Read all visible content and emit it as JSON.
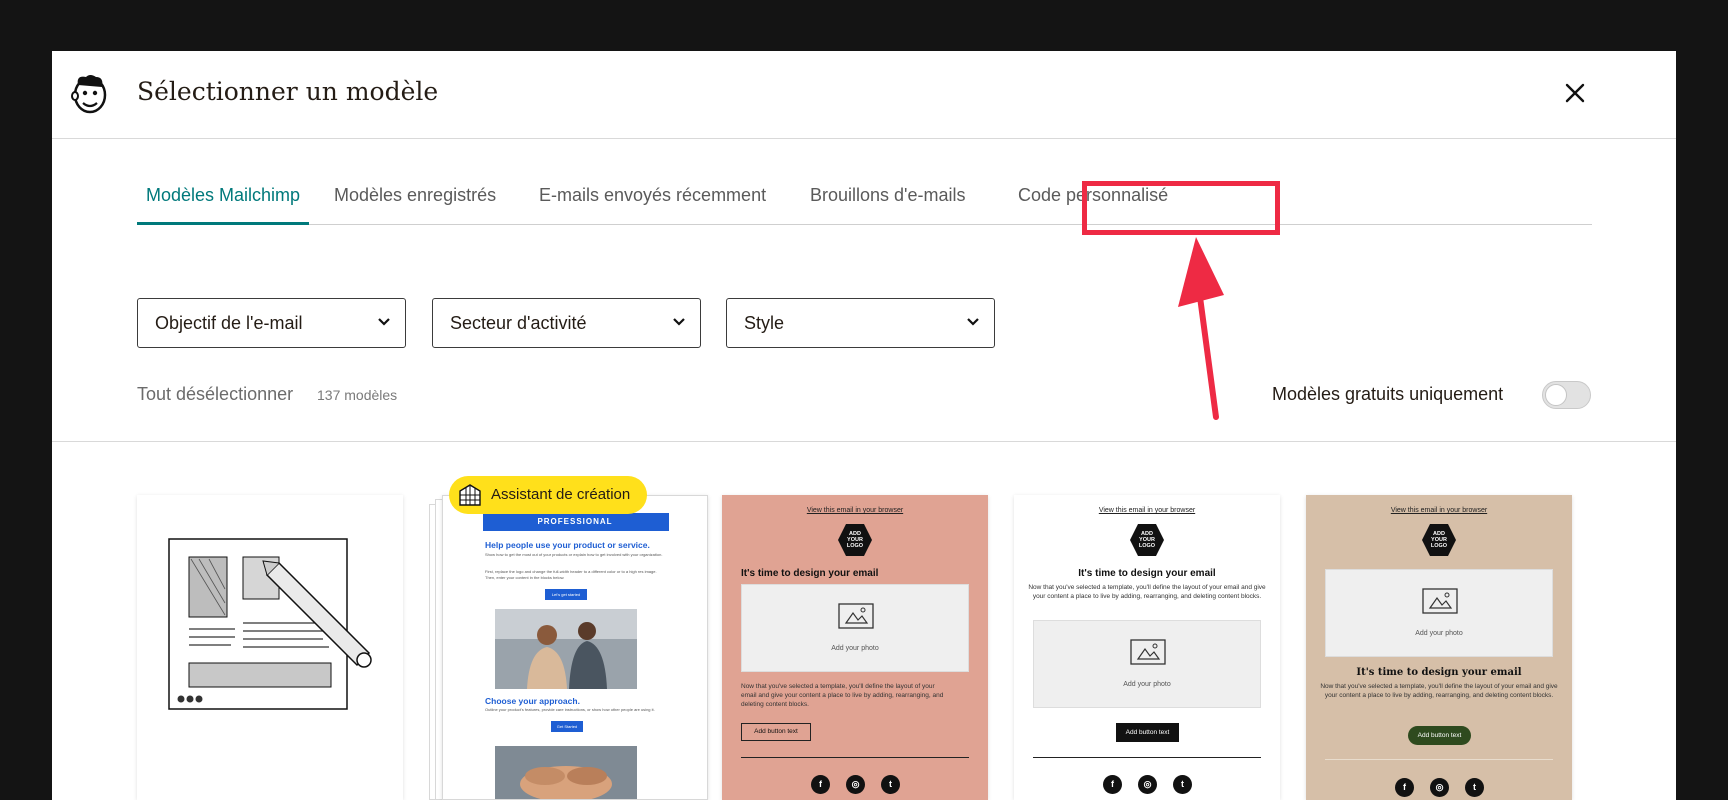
{
  "header": {
    "title": "Sélectionner un modèle"
  },
  "tabs": [
    {
      "label": "Modèles Mailchimp",
      "active": true
    },
    {
      "label": "Modèles enregistrés",
      "active": false
    },
    {
      "label": "E-mails envoyés récemment",
      "active": false
    },
    {
      "label": "Brouillons d'e-mails",
      "active": false
    },
    {
      "label": "Code personnalisé",
      "active": false
    }
  ],
  "filters": [
    {
      "label": "Objectif de l'e-mail"
    },
    {
      "label": "Secteur d'activité"
    },
    {
      "label": "Style"
    }
  ],
  "toolbar": {
    "deselect_label": "Tout désélectionner",
    "count_label": "137 modèles",
    "free_only_label": "Modèles gratuits uniquement",
    "free_only_on": false
  },
  "badge": {
    "label": "Assistant de création"
  },
  "cards": {
    "professional": {
      "banner": "PROFESSIONAL",
      "heading1": "Help people use your product or service.",
      "body1": "Show how to get the most out of your products or explain how to get involved with your organization.",
      "body2": "First, replace the logo and change the full-width header to a different color or to a high res image. Then, enter your content in the blocks below.",
      "button1": "Let's get started",
      "heading2": "Choose your approach.",
      "body3": "Outline your product's features, provide care instructions, or show how other people are using it.",
      "button2": "Get Started"
    },
    "template": {
      "view_link": "View this email in your browser",
      "logo": [
        "ADD",
        "YOUR",
        "LOGO"
      ],
      "heading": "It's time to design your email",
      "photo_label": "Add your photo",
      "body": "Now that you've selected a template, you'll define the layout of your email and give your content a place to live by adding, rearranging, and deleting content blocks.",
      "button": "Add button text"
    }
  },
  "colors": {
    "accent": "#00797b",
    "highlight": "#ee2a44",
    "badge": "#ffe01b",
    "card_pink": "#e0a393",
    "card_tan": "#d6bfa8",
    "card_green_button": "#2e4a1e",
    "professional_blue": "#1e5ed3"
  }
}
